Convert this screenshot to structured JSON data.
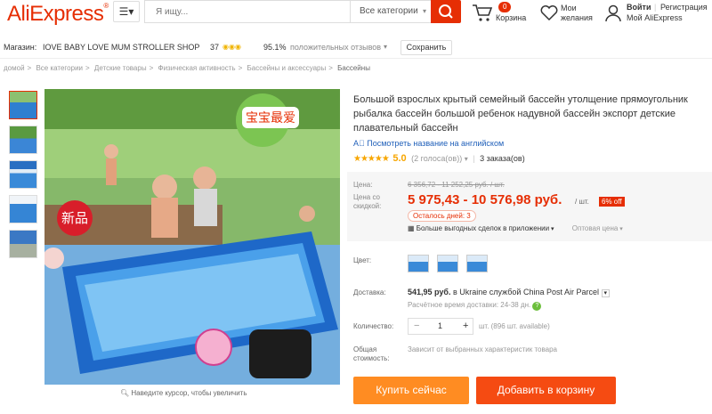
{
  "header": {
    "logo": "AliExpress",
    "search_placeholder": "Я ищу...",
    "category_select": "Все категории",
    "cart_count": "0",
    "cart_label": "Корзина",
    "wishlist_line1": "Мои",
    "wishlist_line2": "желания",
    "login_label": "Войти",
    "register_label": "Регистрация",
    "my_account": "Мой AliExpress"
  },
  "store": {
    "label": "Магазин:",
    "name": "IOVE BABY LOVE MUM STROLLER SHOP",
    "score": "37",
    "feedback_pct": "95.1%",
    "feedback_text": "положительных отзывов",
    "save_button": "Сохранить"
  },
  "breadcrumb": [
    "домой",
    "Все категории",
    "Детские товары",
    "Физическая активность",
    "Бассейны и аксессуары",
    "Бассейны"
  ],
  "gallery": {
    "zoom_hint": "Наведите курсор, чтобы увеличить",
    "badge_new": "新品",
    "badge_love": "宝宝最爱"
  },
  "product": {
    "title": "Большой взрослых крытый семейный бассейн утолщение прямоугольник рыбалка бассейн большой ребенок надувной бассейн экспорт детские плавательный бассейн",
    "english_link": "Посмотреть название на английском",
    "rating": "5.0",
    "votes": "(2 голоса(ов))",
    "orders": "3 заказа(ов)"
  },
  "price": {
    "old_label": "Цена:",
    "old_price": "6 356,72 - 11 252,25 руб. / шт.",
    "new_label_1": "Цена со",
    "new_label_2": "скидкой:",
    "new_price": "5 975,43 - 10 576,98 руб.",
    "per_piece": "/ шт.",
    "discount": "6% off",
    "days_left": "Осталось дней: 3",
    "app_deals": "Больше выгодных сделок в приложении",
    "wholesale": "Оптовая цена"
  },
  "options": {
    "color_label": "Цвет:",
    "shipping_label": "Доставка:",
    "shipping_price": "541,95 руб.",
    "shipping_to": "в Ukraine службой China Post Air Parcel",
    "delivery_time": "Расчётное время доставки: 24-38 дн.",
    "qty_label": "Количество:",
    "qty_value": "1",
    "qty_minus": "−",
    "qty_plus": "+",
    "qty_available": "шт. (896 шт. available)",
    "total_label_1": "Общая",
    "total_label_2": "стоимость:",
    "total_value": "Зависит от выбранных характеристик товара"
  },
  "actions": {
    "buy_now": "Купить сейчас",
    "add_to_cart": "Добавить в корзину"
  },
  "colors": {
    "brand": "#e62e04",
    "buy": "#ff8c22",
    "cart": "#f54b12",
    "link": "#1f5fb9",
    "star": "#f7a600"
  }
}
